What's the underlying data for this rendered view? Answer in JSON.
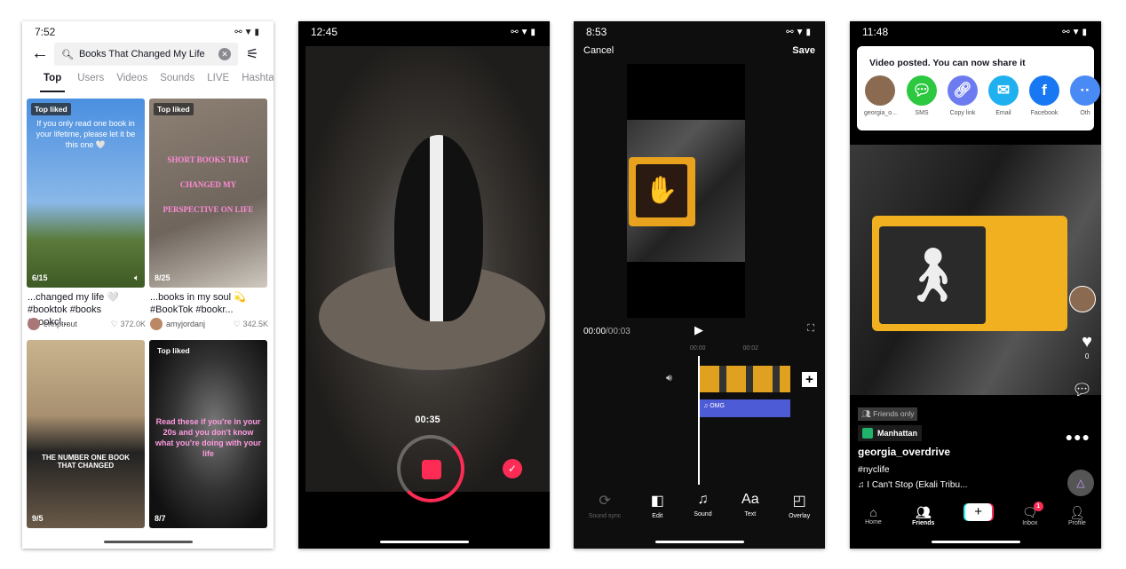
{
  "search_screen": {
    "time": "7:52",
    "query": "Books That Changed My Life",
    "tabs": [
      "Top",
      "Users",
      "Videos",
      "Sounds",
      "LIVE",
      "Hashtags"
    ],
    "results": [
      {
        "badge": "Top liked",
        "overlay": "If you only read one book in your lifetime, please let it be this one 🤍",
        "count": "6/15",
        "caption": "...changed my life 🤍 #booktok #books #bookcl...",
        "user": "erinptrout",
        "likes": "372.0K"
      },
      {
        "badge": "Top liked",
        "overlay": "SHORT BOOKS THAT CHANGED MY PERSPECTIVE ON LIFE",
        "count": "8/25",
        "caption": "...books in my soul 💫 #BookTok #bookr...",
        "user": "amyjordanj",
        "likes": "342.5K"
      },
      {
        "badge": "",
        "overlay": "THE NUMBER ONE BOOK THAT CHANGED",
        "count": "9/5"
      },
      {
        "badge": "Top liked",
        "overlay": "Read these if you're in your 20s and you don't know what you're doing with your life",
        "count": "8/7"
      }
    ]
  },
  "camera_screen": {
    "time": "12:45",
    "timer": "00:35",
    "accent": "#fe2c55"
  },
  "editor_screen": {
    "time": "8:53",
    "cancel": "Cancel",
    "save": "Save",
    "current_time": "00:00",
    "total_time": "/00:03",
    "ticks": [
      "00:00",
      "00:02"
    ],
    "audio_label": "OMG",
    "tools": [
      {
        "icon": "sound-sync-icon",
        "label": "Sound sync",
        "enabled": false
      },
      {
        "icon": "edit-icon",
        "label": "Edit",
        "enabled": true
      },
      {
        "icon": "music-note-icon",
        "label": "Sound",
        "enabled": true
      },
      {
        "icon": "text-icon",
        "label": "Text",
        "enabled": true
      },
      {
        "icon": "overlay-icon",
        "label": "Overlay",
        "enabled": true
      }
    ]
  },
  "posted_screen": {
    "time": "11:48",
    "share_title": "Video posted. You can now share it",
    "share_targets": [
      {
        "label": "georgia_o...",
        "color": "#8a6a50"
      },
      {
        "label": "SMS",
        "color": "#2bc840"
      },
      {
        "label": "Copy link",
        "color": "#6c7cf0"
      },
      {
        "label": "Email",
        "color": "#1fb0f0"
      },
      {
        "label": "Facebook",
        "color": "#1877f2"
      },
      {
        "label": "Oth",
        "color": "#4a8af4"
      }
    ],
    "like_count": "0",
    "privacy": "Friends only",
    "location": "Manhattan",
    "username": "georgia_overdrive",
    "hashtag": "#nyclife",
    "sound": "♫ I Can't Stop (Ekali Tribu...",
    "nav": [
      "Home",
      "Friends",
      "",
      "Inbox",
      "Profile"
    ],
    "inbox_badge": "1"
  }
}
